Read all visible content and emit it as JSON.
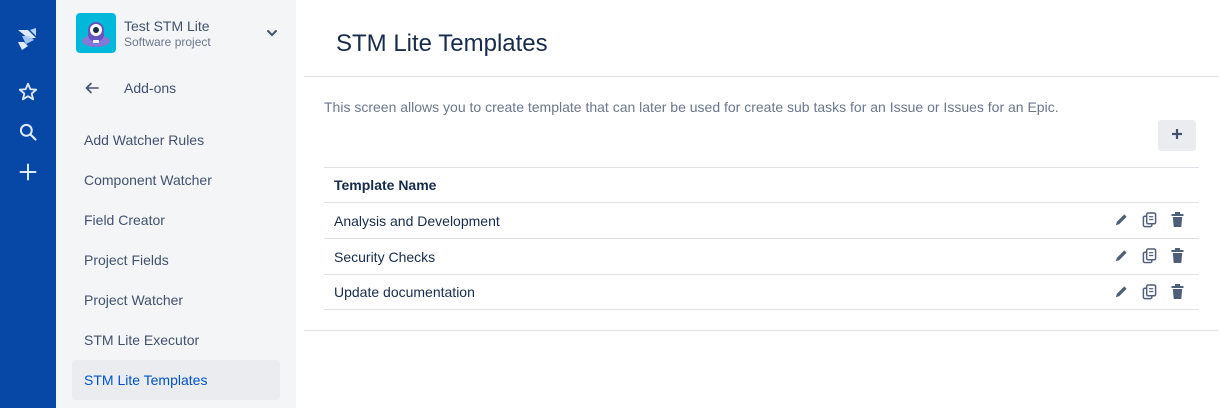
{
  "global_nav": {
    "icons": [
      "jira-logo-icon",
      "star-icon",
      "search-icon",
      "plus-icon"
    ]
  },
  "project": {
    "name": "Test STM Lite",
    "type": "Software project"
  },
  "sidebar": {
    "back_label": "Add-ons",
    "items": [
      {
        "label": "Add Watcher Rules"
      },
      {
        "label": "Component Watcher"
      },
      {
        "label": "Field Creator"
      },
      {
        "label": "Project Fields"
      },
      {
        "label": "Project Watcher"
      },
      {
        "label": "STM Lite Executor"
      },
      {
        "label": "STM Lite Templates",
        "active": true
      }
    ]
  },
  "main": {
    "title": "STM Lite Templates",
    "description": "This screen allows you to create template that can later be used for create sub tasks for an Issue or Issues for an Epic.",
    "add_button_icon": "plus-icon",
    "table": {
      "header": "Template Name",
      "rows": [
        {
          "name": "Analysis and Development"
        },
        {
          "name": "Security Checks"
        },
        {
          "name": "Update documentation"
        }
      ],
      "row_actions": [
        "edit-icon",
        "copy-icon",
        "delete-icon"
      ]
    }
  },
  "colors": {
    "nav_bg": "#0747a6",
    "sidebar_bg": "#f4f5f7",
    "active_text": "#0052cc",
    "active_bg": "#ebecf0"
  }
}
